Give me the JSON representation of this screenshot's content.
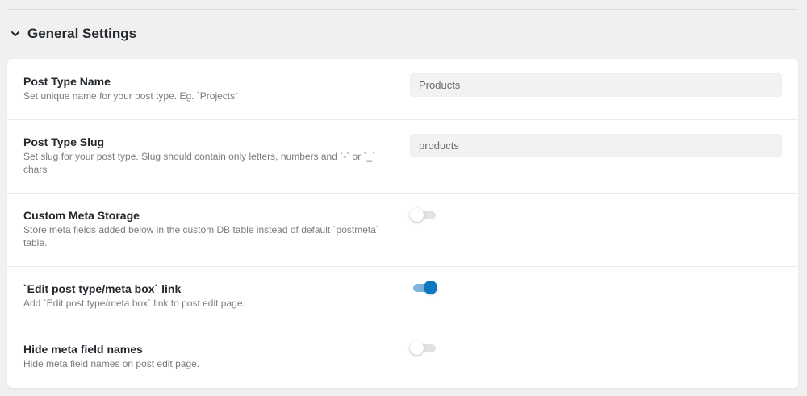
{
  "section": {
    "title": "General Settings",
    "icon": "chevron-down-icon"
  },
  "colors": {
    "page_background": "#f0f0f1",
    "panel_background": "#ffffff",
    "toggle_on": "#0d77bf",
    "toggle_on_track": "#7fb3d9",
    "toggle_off_track": "#e2e2e2"
  },
  "settings": {
    "post_type_name": {
      "title": "Post Type Name",
      "description": "Set unique name for your post type. Eg. `Projects`",
      "value": "Products",
      "placeholder": ""
    },
    "post_type_slug": {
      "title": "Post Type Slug",
      "description": "Set slug for your post type. Slug should contain only letters, numbers and `-` or `_` chars",
      "value": "products",
      "placeholder": ""
    },
    "custom_meta_storage": {
      "title": "Custom Meta Storage",
      "description": "Store meta fields added below in the custom DB table instead of default `postmeta` table.",
      "enabled": false
    },
    "edit_link": {
      "title": "`Edit post type/meta box` link",
      "description": "Add `Edit post type/meta box` link to post edit page.",
      "enabled": true
    },
    "hide_meta_field_names": {
      "title": "Hide meta field names",
      "description": "Hide meta field names on post edit page.",
      "enabled": false
    }
  }
}
